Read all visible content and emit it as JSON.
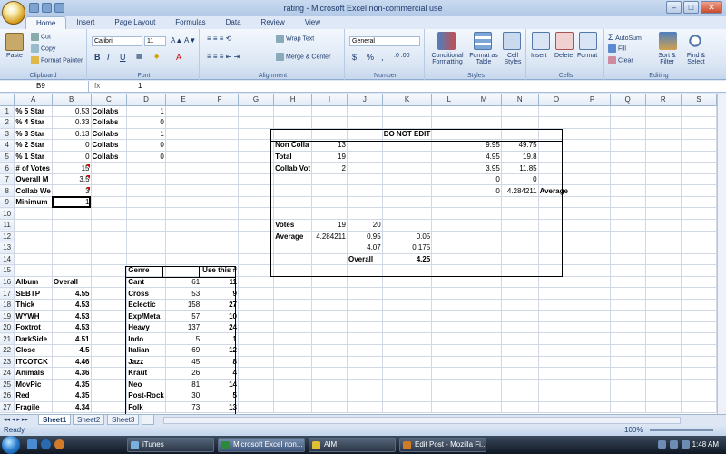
{
  "window": {
    "title": "rating - Microsoft Excel non-commercial use"
  },
  "tabs": [
    "Home",
    "Insert",
    "Page Layout",
    "Formulas",
    "Data",
    "Review",
    "View"
  ],
  "ribbon": {
    "clipboard": {
      "label": "Clipboard",
      "paste": "Paste",
      "cut": "Cut",
      "copy": "Copy",
      "format_painter": "Format Painter"
    },
    "font": {
      "label": "Font",
      "name": "Calibri",
      "size": "11",
      "bold": "B",
      "italic": "I",
      "underline": "U"
    },
    "alignment": {
      "label": "Alignment",
      "wrap": "Wrap Text",
      "merge": "Merge & Center"
    },
    "number": {
      "label": "Number",
      "format": "General",
      "currency": "$",
      "percent": "%",
      "comma": ","
    },
    "styles": {
      "label": "Styles",
      "conditional": "Conditional Formatting",
      "format_table": "Format as Table",
      "cell_styles": "Cell Styles"
    },
    "cells": {
      "label": "Cells",
      "insert": "Insert",
      "delete": "Delete",
      "format": "Format"
    },
    "editing": {
      "label": "Editing",
      "autosum": "AutoSum",
      "fill": "Fill",
      "clear": "Clear",
      "sort": "Sort & Filter",
      "find": "Find & Select"
    }
  },
  "formula_bar": {
    "name_box": "B9",
    "fx": "fx",
    "value": "1"
  },
  "columns": [
    "A",
    "B",
    "C",
    "D",
    "E",
    "F",
    "G",
    "H",
    "I",
    "J",
    "K",
    "L",
    "M",
    "N",
    "O",
    "P",
    "Q",
    "R",
    "S"
  ],
  "rows": [
    {
      "n": "1",
      "cells": {
        "A": "% 5 Star",
        "B": "0.53",
        "C": "Collabs",
        "D": "1"
      }
    },
    {
      "n": "2",
      "cells": {
        "A": "% 4 Star",
        "B": "0.33",
        "C": "Collabs",
        "D": "0"
      }
    },
    {
      "n": "3",
      "cells": {
        "A": "% 3 Star",
        "B": "0.13",
        "C": "Collabs",
        "D": "1",
        "K": "DO NOT EDIT"
      }
    },
    {
      "n": "4",
      "cells": {
        "A": "% 2 Star",
        "B": "0",
        "C": "Collabs",
        "D": "0",
        "H": "Non Colla",
        "I": "13",
        "M": "9.95",
        "N": "49.75"
      }
    },
    {
      "n": "5",
      "cells": {
        "A": "% 1 Star",
        "B": "0",
        "C": "Collabs",
        "D": "0",
        "H": "Total",
        "I": "19",
        "M": "4.95",
        "N": "19.8"
      }
    },
    {
      "n": "6",
      "cells": {
        "A": "# of Votes",
        "B": "15",
        "H": "Collab Vot",
        "I": "2",
        "M": "3.95",
        "N": "11.85"
      }
    },
    {
      "n": "7",
      "cells": {
        "A": "Overall M",
        "B": "3.5",
        "M": "0",
        "N": "0"
      }
    },
    {
      "n": "8",
      "cells": {
        "A": "Collab We",
        "B": "3",
        "M": "0",
        "N": "4.284211",
        "O": "Average"
      }
    },
    {
      "n": "9",
      "cells": {
        "A": "Minimum",
        "B": "1"
      }
    },
    {
      "n": "10",
      "cells": {}
    },
    {
      "n": "11",
      "cells": {
        "H": "Votes",
        "I": "19",
        "J": "20"
      }
    },
    {
      "n": "12",
      "cells": {
        "H": "Average",
        "I": "4.284211",
        "J": "0.95",
        "K": "0.05"
      }
    },
    {
      "n": "13",
      "cells": {
        "J": "4.07",
        "K": "0.175"
      }
    },
    {
      "n": "14",
      "cells": {
        "J": "Overall",
        "K": "4.25"
      }
    },
    {
      "n": "15",
      "cells": {
        "D": "Genre",
        "F": "Use this #"
      }
    },
    {
      "n": "16",
      "cells": {
        "A": "Album",
        "B": "Overall",
        "D": "Cant",
        "E": "61",
        "F": "11"
      }
    },
    {
      "n": "17",
      "cells": {
        "A": "SEBTP",
        "B": "4.55",
        "D": "Cross",
        "E": "53",
        "F": "9"
      }
    },
    {
      "n": "18",
      "cells": {
        "A": "Thick",
        "B": "4.53",
        "D": "Eclectic",
        "E": "158",
        "F": "27"
      }
    },
    {
      "n": "19",
      "cells": {
        "A": "WYWH",
        "B": "4.53",
        "D": "Exp/Meta",
        "E": "57",
        "F": "10"
      }
    },
    {
      "n": "20",
      "cells": {
        "A": "Foxtrot",
        "B": "4.53",
        "D": "Heavy",
        "E": "137",
        "F": "24"
      }
    },
    {
      "n": "21",
      "cells": {
        "A": "DarkSide",
        "B": "4.51",
        "D": "Indo",
        "E": "5",
        "F": "1"
      }
    },
    {
      "n": "22",
      "cells": {
        "A": "Close",
        "B": "4.5",
        "D": "Italian",
        "E": "69",
        "F": "12"
      }
    },
    {
      "n": "23",
      "cells": {
        "A": "ITCOTCK",
        "B": "4.46",
        "D": "Jazz",
        "E": "45",
        "F": "8"
      }
    },
    {
      "n": "24",
      "cells": {
        "A": "Animals",
        "B": "4.36",
        "D": "Kraut",
        "E": "26",
        "F": "4"
      }
    },
    {
      "n": "25",
      "cells": {
        "A": "MovPic",
        "B": "4.35",
        "D": "Neo",
        "E": "81",
        "F": "14"
      }
    },
    {
      "n": "26",
      "cells": {
        "A": "Red",
        "B": "4.35",
        "D": "Post-Rock",
        "E": "30",
        "F": "5"
      }
    },
    {
      "n": "27",
      "cells": {
        "A": "Fragile",
        "B": "4.34",
        "D": "Folk",
        "E": "73",
        "F": "13"
      }
    }
  ],
  "sheets": [
    "Sheet1",
    "Sheet2",
    "Sheet3"
  ],
  "status": {
    "text": "Ready",
    "zoom": "100%"
  },
  "taskbar": {
    "items": [
      "iTunes",
      "Microsoft Excel non...",
      "AIM",
      "Edit Post - Mozilla Fi..."
    ],
    "clock": "1:48 AM"
  }
}
